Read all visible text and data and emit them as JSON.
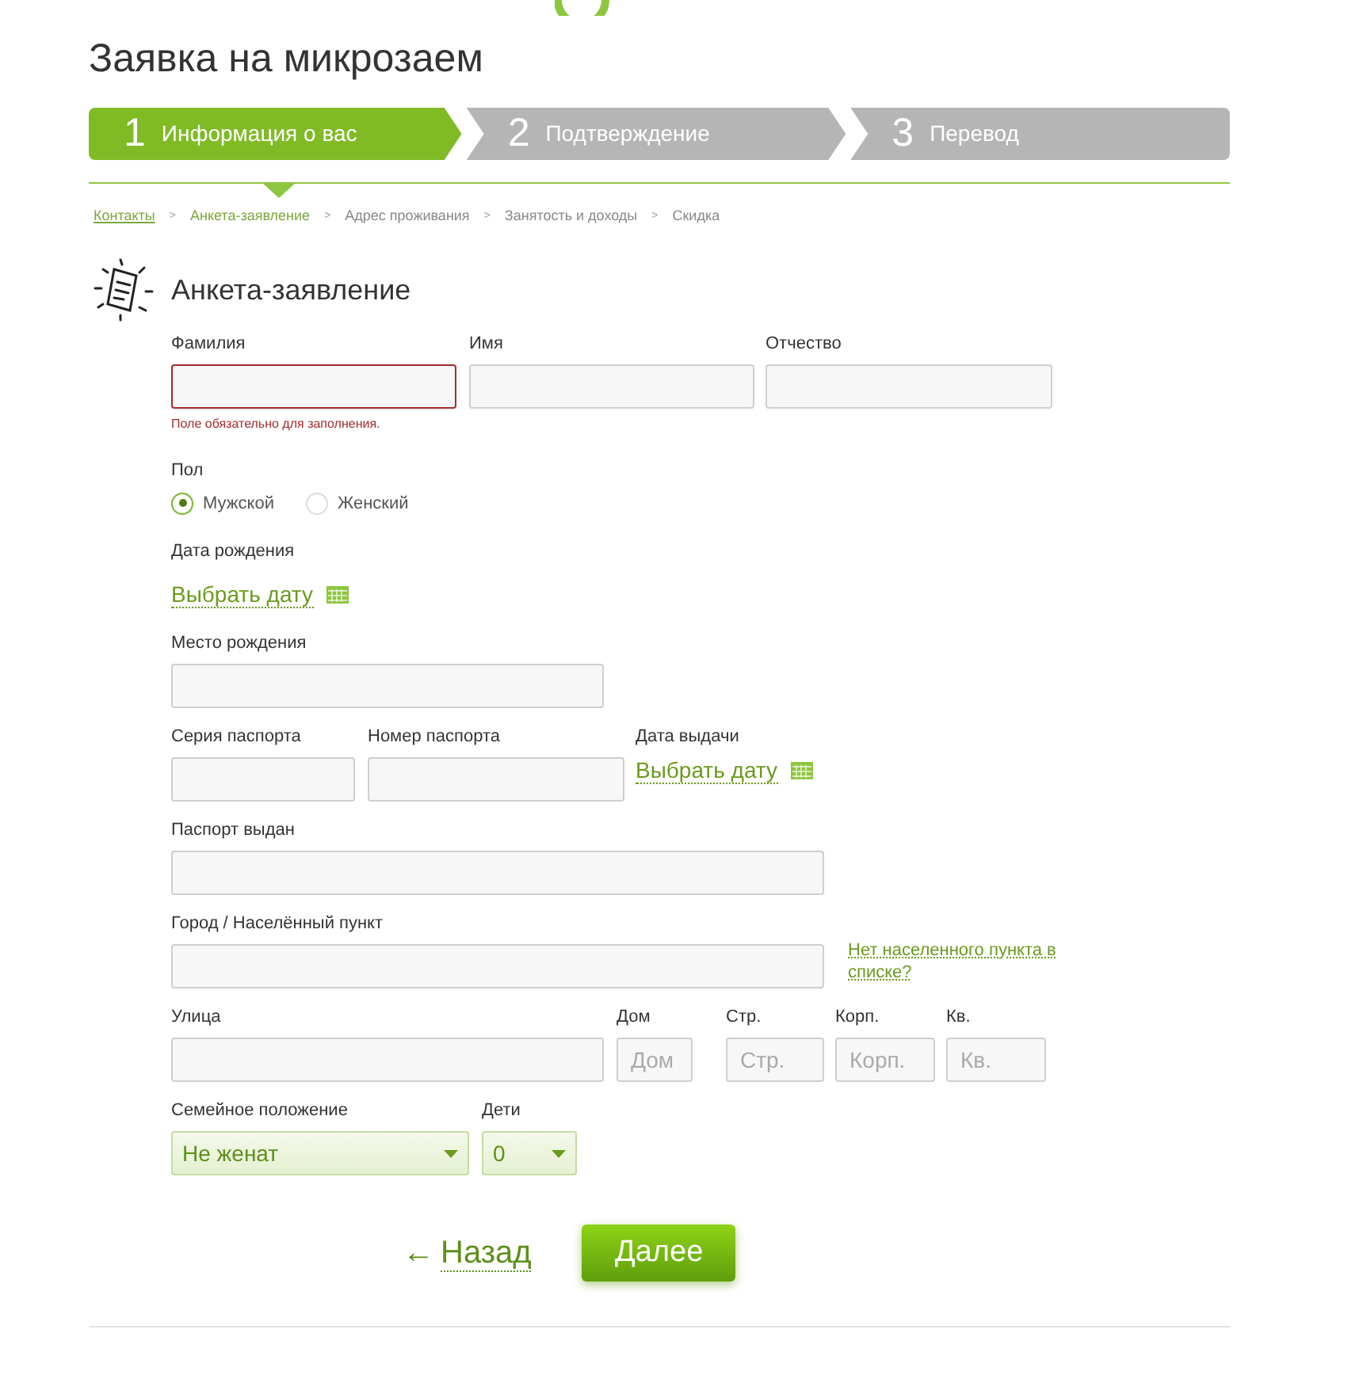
{
  "title": "Заявка на микрозаем",
  "steps": [
    {
      "number": "1",
      "label": "Информация о вас",
      "selected": true
    },
    {
      "number": "2",
      "label": "Подтверждение",
      "selected": false
    },
    {
      "number": "3",
      "label": "Перевод",
      "selected": false
    }
  ],
  "breadcrumb": [
    {
      "label": "Контакты",
      "kind": "link",
      "separator": ">"
    },
    {
      "label": "Анкета-заявление",
      "kind": "current",
      "separator": ">"
    },
    {
      "label": "Адрес проживания",
      "kind": "plain",
      "separator": ">"
    },
    {
      "label": "Занятость и доходы",
      "kind": "plain",
      "separator": ">"
    },
    {
      "label": "Скидка",
      "kind": "plain"
    }
  ],
  "section_title": "Анкета-заявление",
  "rows": [
    {
      "fields": [
        {
          "kind": "text",
          "label": "Фамилия",
          "invalid": true,
          "error": "Поле обязательно для заполнения."
        },
        {
          "kind": "text",
          "label": "Имя",
          "invalid": false
        },
        {
          "kind": "text",
          "label": "Отчество",
          "invalid": false
        }
      ]
    },
    {
      "fields": [
        {
          "kind": "radio",
          "label": "Пол",
          "options": [
            {
              "label": "Мужской",
              "selected": true
            },
            {
              "label": "Женский",
              "selected": false
            }
          ]
        }
      ]
    },
    {
      "fields": [
        {
          "kind": "date",
          "label": "Дата рождения",
          "link": "Выбрать дату"
        }
      ]
    },
    {
      "fields": [
        {
          "kind": "text",
          "label": "Место рождения",
          "invalid": false
        }
      ]
    },
    {
      "fields": [
        {
          "kind": "text",
          "label": "Серия паспорта",
          "invalid": false
        },
        {
          "kind": "text",
          "label": "Номер паспорта",
          "invalid": false
        },
        {
          "kind": "date",
          "label": "Дата выдачи",
          "link": "Выбрать дату"
        }
      ]
    },
    {
      "fields": [
        {
          "kind": "text",
          "label": "Паспорт выдан",
          "invalid": false
        }
      ]
    },
    {
      "fields": [
        {
          "kind": "text",
          "label": "Город / Населённый пункт",
          "invalid": false
        },
        {
          "kind": "note",
          "link": "Нет населенного пункта в списке?"
        }
      ]
    },
    {
      "fields": [
        {
          "kind": "text",
          "label": "Улица",
          "invalid": false
        },
        {
          "kind": "text",
          "label": "Дом",
          "placeholder": "Дом",
          "invalid": false
        },
        {
          "kind": "text",
          "label": "Стр.",
          "placeholder": "Стр.",
          "invalid": false
        },
        {
          "kind": "text",
          "label": "Корп.",
          "placeholder": "Корп.",
          "invalid": false
        },
        {
          "kind": "text",
          "label": "Кв.",
          "placeholder": "Кв.",
          "invalid": false
        }
      ]
    },
    {
      "fields": [
        {
          "kind": "select",
          "label": "Семейное положение",
          "value": "Не женат"
        },
        {
          "kind": "select",
          "label": "Дети",
          "value": "0"
        }
      ]
    }
  ],
  "back": {
    "arrow": "←",
    "label": "Назад"
  },
  "next": "Далее"
}
